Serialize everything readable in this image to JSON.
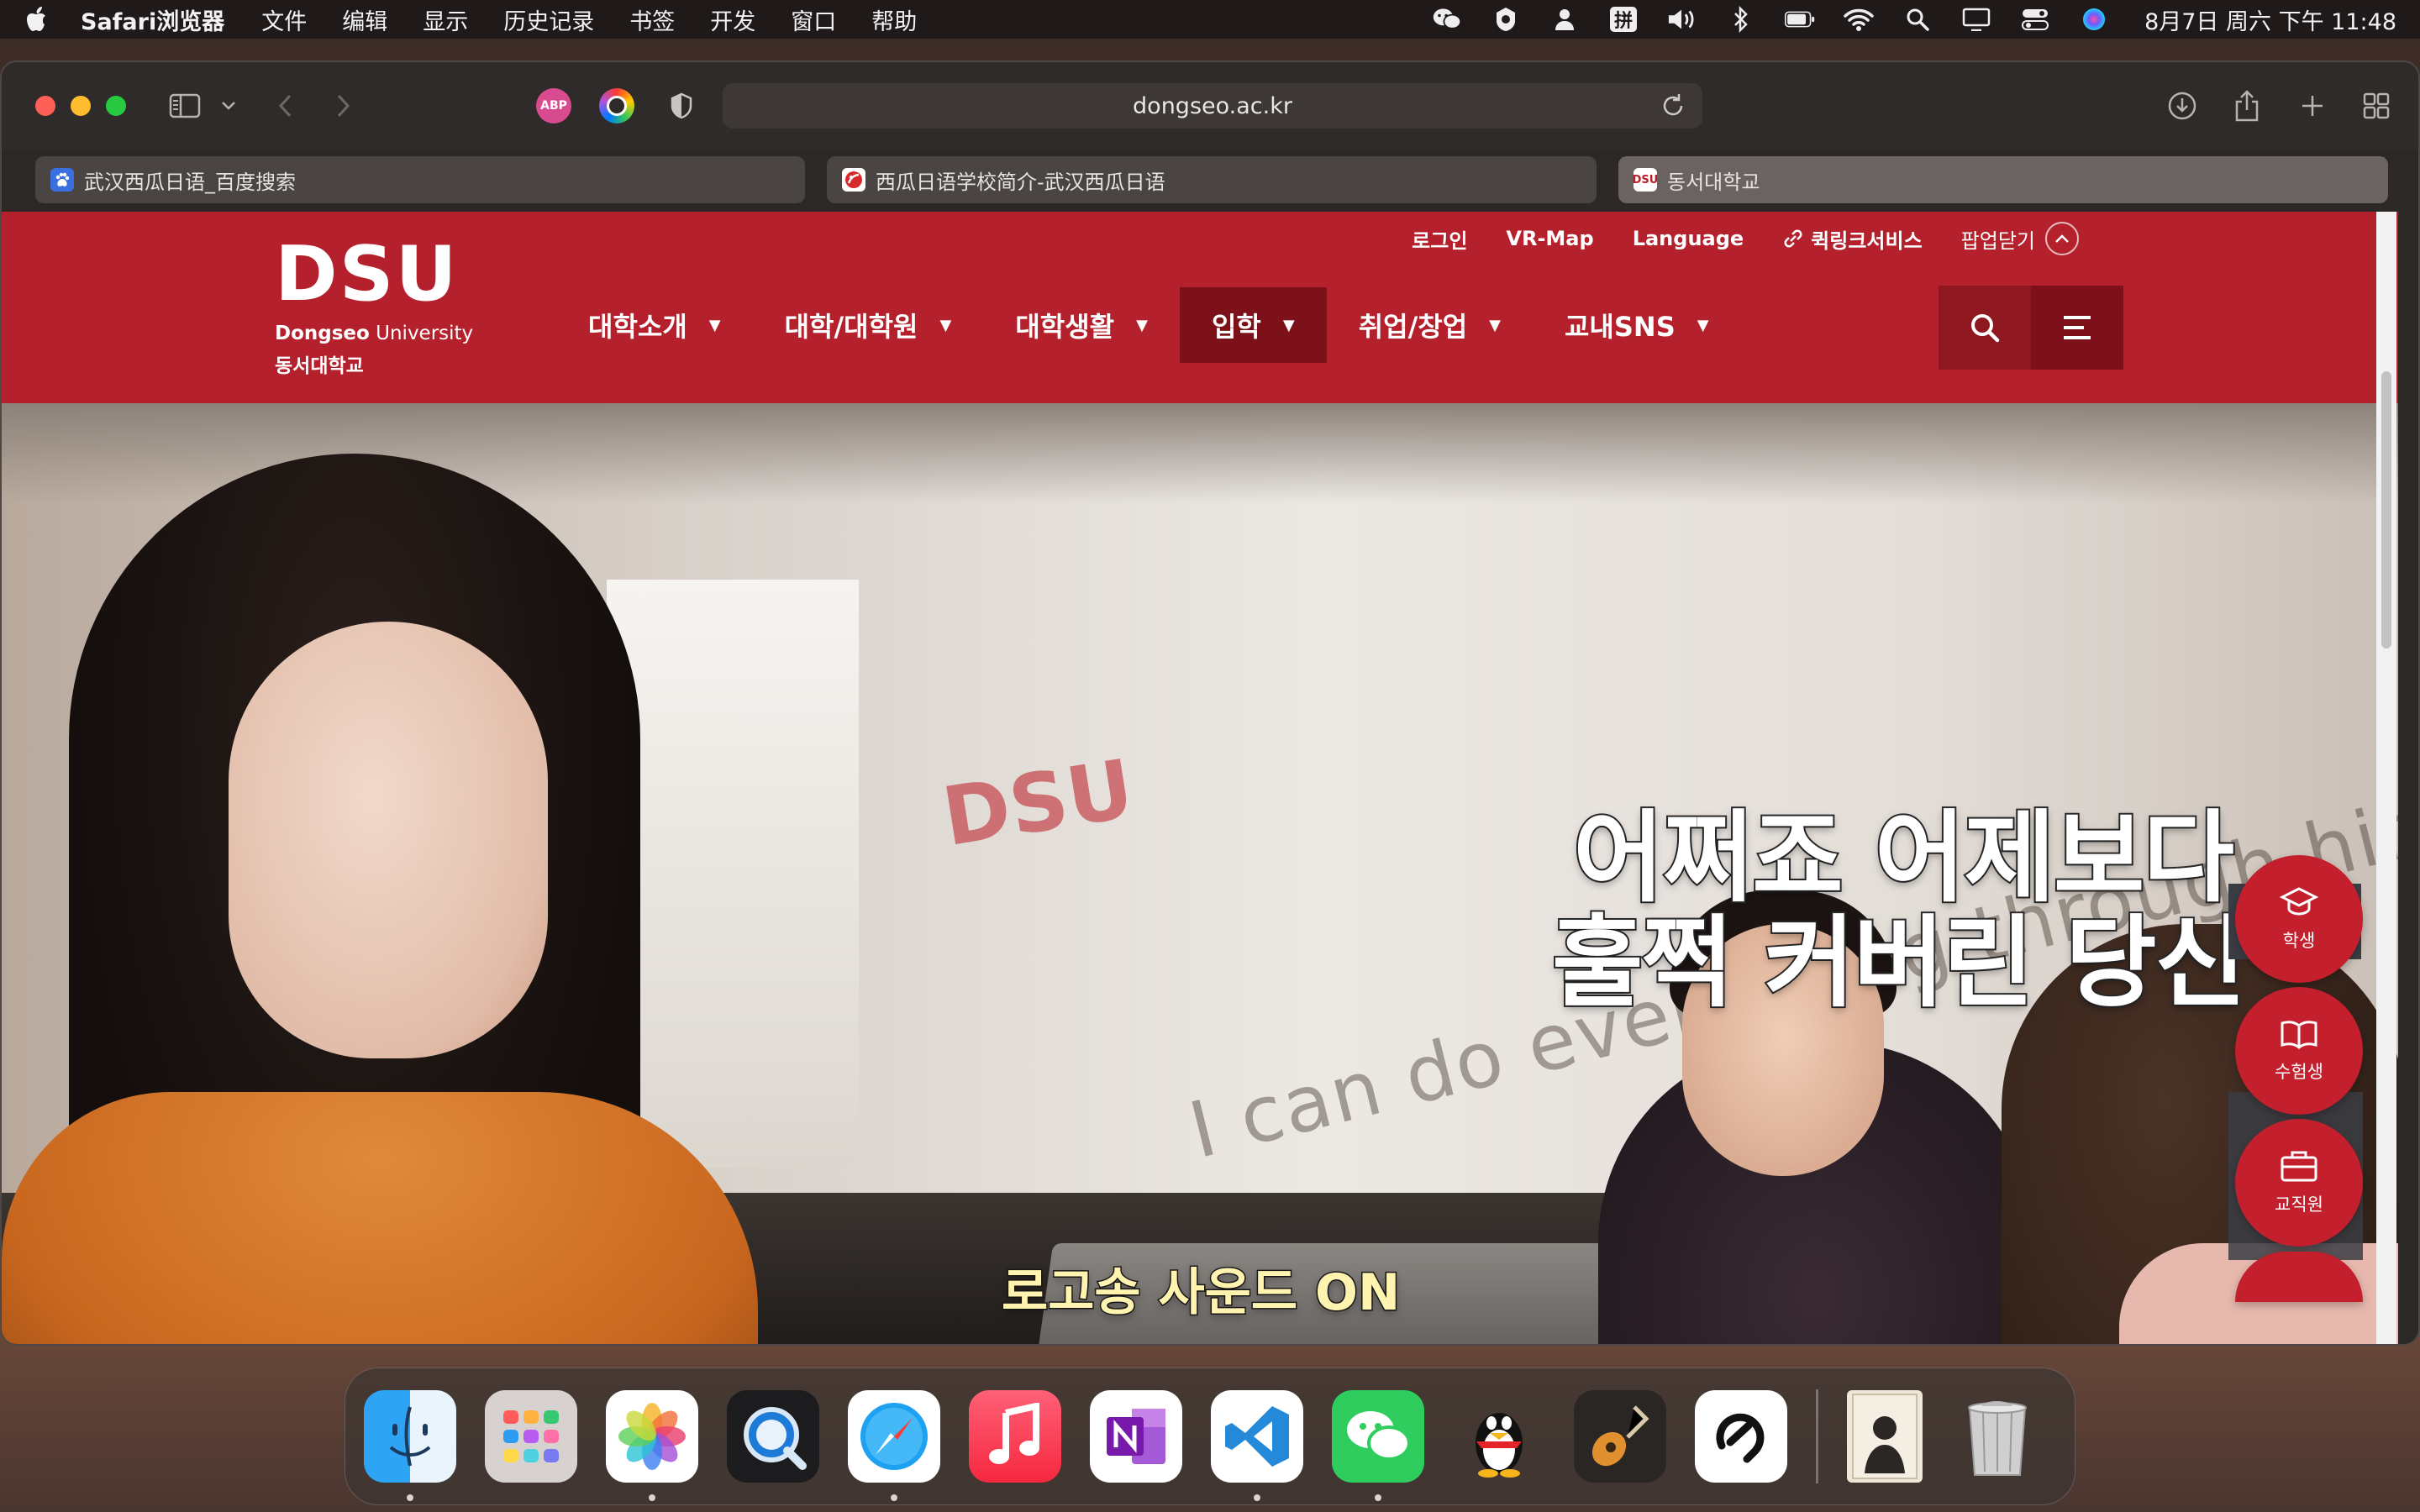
{
  "menubar": {
    "app_name": "Safari浏览器",
    "menus": [
      "文件",
      "编辑",
      "显示",
      "历史记录",
      "书签",
      "开发",
      "窗口",
      "帮助"
    ],
    "status_icons": [
      "wechat-icon",
      "shield-status-icon",
      "user-icon",
      "input-method-icon",
      "volume-icon",
      "bluetooth-icon",
      "battery-icon",
      "wifi-icon",
      "spotlight-icon",
      "display-icon",
      "control-center-icon",
      "siri-icon"
    ],
    "input_method_label": "拼",
    "clock": "8月7日 周六 下午 11:48"
  },
  "browser": {
    "url": "dongseo.ac.kr",
    "extensions": [
      {
        "name": "adblock-plus-icon",
        "label": "ABP"
      },
      {
        "name": "color-picker-icon",
        "label": ""
      },
      {
        "name": "privacy-shield-icon",
        "label": ""
      }
    ],
    "tabs": [
      {
        "title": "武汉西瓜日语_百度搜索",
        "favicon": "baidu-icon",
        "active": false
      },
      {
        "title": "西瓜日语学校简介-武汉西瓜日语",
        "favicon": "xigua-icon",
        "active": false
      },
      {
        "title": "동서대학교",
        "favicon": "dsu-icon",
        "favicon_label": "DSU",
        "active": true
      }
    ]
  },
  "site": {
    "logo": {
      "mark": "DSU",
      "english_bold": "Dongseo",
      "english_rest": " University",
      "korean": "동서대학교"
    },
    "utility_links": [
      "로그인",
      "VR-Map",
      "Language",
      "퀵링크서비스"
    ],
    "popup_close": "팝업닫기",
    "nav": [
      {
        "label": "대학소개",
        "active": false
      },
      {
        "label": "대학/대학원",
        "active": false
      },
      {
        "label": "대학생활",
        "active": false
      },
      {
        "label": "입학",
        "active": true
      },
      {
        "label": "취업/창업",
        "active": false
      },
      {
        "label": "교내SNS",
        "active": false
      }
    ],
    "hero": {
      "caption_line1": "어쩌죠 어제보다",
      "caption_line2": "훌쩍 커버린 당신",
      "caption_bottom": "로고송 사운드 ON",
      "wall_text": "I can do everything through him who",
      "wall_logo": "DSU"
    },
    "quick_menu": [
      {
        "label": "학생",
        "icon": "graduation-cap-icon"
      },
      {
        "label": "수험생",
        "icon": "open-book-icon"
      },
      {
        "label": "교직원",
        "icon": "briefcase-icon"
      }
    ]
  },
  "colors": {
    "brand_red": "#b4202b",
    "nav_active": "#7c1119",
    "quick_red": "#c31f2d"
  },
  "dock": {
    "apps": [
      {
        "name": "finder",
        "running": true
      },
      {
        "name": "launchpad",
        "running": false
      },
      {
        "name": "photos",
        "running": true
      },
      {
        "name": "quicktime",
        "running": false
      },
      {
        "name": "safari",
        "running": true
      },
      {
        "name": "music",
        "running": false
      },
      {
        "name": "onenote",
        "running": false
      },
      {
        "name": "vscode",
        "running": true
      },
      {
        "name": "wechat",
        "running": true
      },
      {
        "name": "qq",
        "running": false
      },
      {
        "name": "garageband",
        "running": false
      },
      {
        "name": "clip-studio",
        "running": false
      }
    ],
    "recent": [
      {
        "name": "downloads-stack"
      },
      {
        "name": "trash"
      }
    ]
  }
}
